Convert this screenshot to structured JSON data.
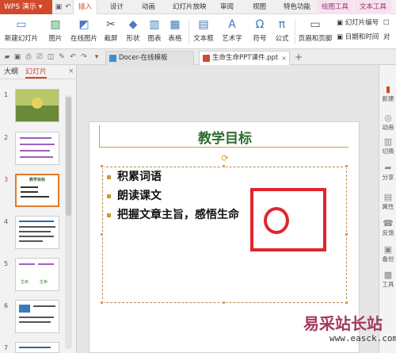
{
  "app": {
    "title": "WPS 演示"
  },
  "menu_tabs": [
    "插入",
    "设计",
    "动画",
    "幻灯片放映",
    "审阅",
    "视图",
    "特色功能",
    "绘图工具",
    "文本工具"
  ],
  "ribbon": {
    "new_slide": "新建幻灯片",
    "picture": "图片",
    "online_picture": "在线图片",
    "screenshot": "截屏",
    "shape": "形状",
    "chart": "图表",
    "table": "表格",
    "textbox": "文本框",
    "wordart": "艺术字",
    "symbol": "符号",
    "formula": "公式",
    "header_footer": "页眉和页脚",
    "slide_number": "幻灯片编号",
    "date_time": "日期和时间",
    "object": "对"
  },
  "doc_tabs": [
    {
      "label": "Docer-在线模板"
    },
    {
      "label": "生命生命PPT课件.ppt"
    }
  ],
  "left_panel": {
    "tab_outline": "大纲",
    "tab_slides": "幻灯片",
    "close": "×"
  },
  "slide_numbers": [
    "1",
    "2",
    "3",
    "4",
    "5",
    "6",
    "7"
  ],
  "thumb_text": {
    "s3_title": "教学目标",
    "s5_a": "生命",
    "s5_b": "生命"
  },
  "slide": {
    "title": "教学目标",
    "bullets": [
      "积累词语",
      "朗读课文",
      "把握文章主旨，感悟生命"
    ]
  },
  "right_bar": [
    {
      "label": "新建",
      "icon": "new-icon"
    },
    {
      "label": "动画",
      "icon": "animation-icon"
    },
    {
      "label": "切换",
      "icon": "transition-icon"
    },
    {
      "label": "分享",
      "icon": "share-icon"
    },
    {
      "label": "属性",
      "icon": "properties-icon"
    },
    {
      "label": "反馈",
      "icon": "feedback-icon"
    },
    {
      "label": "备份",
      "icon": "backup-icon"
    },
    {
      "label": "工具",
      "icon": "tools-icon"
    }
  ],
  "watermark": {
    "cn": "易采站长站",
    "url": "www.easck.com"
  },
  "colors": {
    "accent": "#d14a2c",
    "title_green": "#2e6b2e",
    "annotation_red": "#e0262b"
  }
}
